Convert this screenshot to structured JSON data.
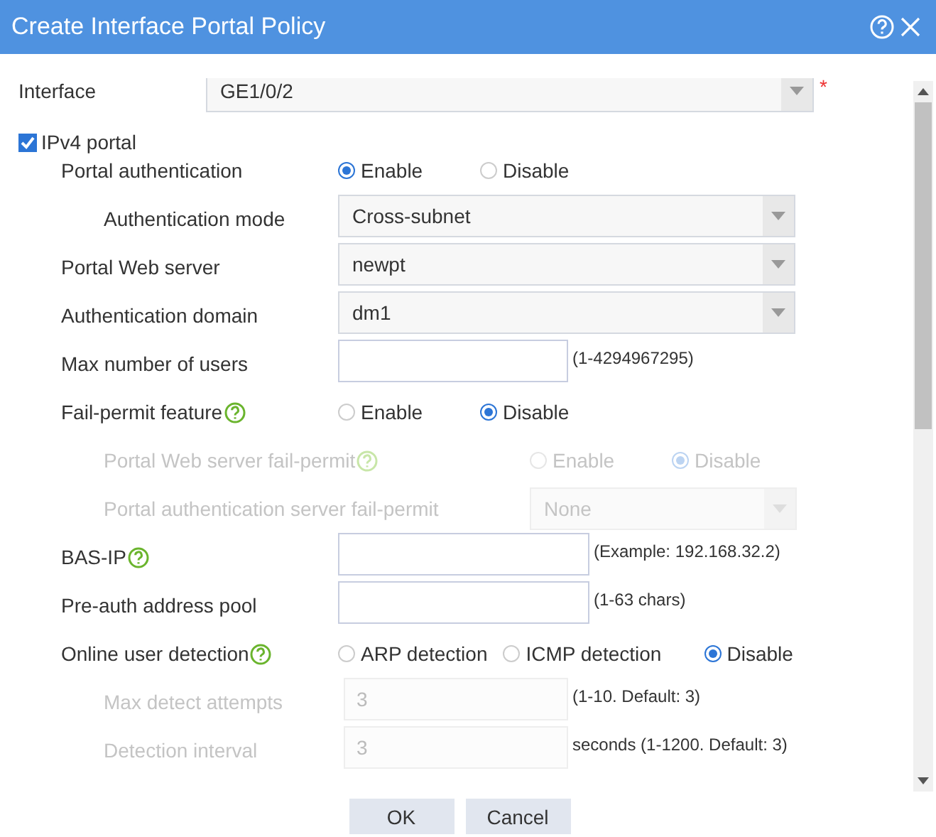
{
  "window": {
    "title": "Create Interface Portal Policy"
  },
  "rows": [
    {
      "kind": "select",
      "label": "Interface",
      "value": "GE1/0/2",
      "required_mark": "*"
    },
    {
      "kind": "checkbox",
      "label": "IPv4 portal",
      "checked": true,
      "children": [
        {
          "kind": "radio",
          "label": "Portal authentication",
          "options": [
            {
              "label": "Enable",
              "selected": true
            },
            {
              "label": "Disable",
              "selected": false
            }
          ],
          "children": [
            {
              "kind": "select",
              "label": "Authentication mode",
              "value": "Cross-subnet"
            }
          ]
        },
        {
          "kind": "select",
          "label": "Portal Web server",
          "value": "newpt"
        },
        {
          "kind": "select",
          "label": "Authentication domain",
          "value": "dm1"
        },
        {
          "kind": "text",
          "label": "Max number of users",
          "hint": "(1-4294967295)"
        },
        {
          "kind": "radio",
          "label": "Fail-permit feature",
          "help": true,
          "options": [
            {
              "label": "Enable",
              "selected": false
            },
            {
              "label": "Disable",
              "selected": true
            }
          ],
          "children": [
            {
              "kind": "radio",
              "label": "Portal Web server fail-permit",
              "help": true,
              "disabled": true,
              "options": [
                {
                  "label": "Enable",
                  "selected": false
                },
                {
                  "label": "Disable",
                  "selected": true
                }
              ]
            },
            {
              "kind": "select",
              "label": "Portal authentication server fail-permit",
              "value": "None",
              "disabled": true
            }
          ]
        },
        {
          "kind": "text",
          "label": "BAS-IP",
          "help": true,
          "hint": "(Example: 192.168.32.2)"
        },
        {
          "kind": "text",
          "label": "Pre-auth address pool",
          "hint": "(1-63 chars)"
        },
        {
          "kind": "radio",
          "label": "Online user detection",
          "help": true,
          "options": [
            {
              "label": "ARP detection",
              "selected": false
            },
            {
              "label": "ICMP detection",
              "selected": false
            },
            {
              "label": "Disable",
              "selected": true
            }
          ],
          "children": [
            {
              "kind": "text",
              "label": "Max detect attempts",
              "value": "3",
              "hint": "(1-10. Default: 3)",
              "disabled": true
            },
            {
              "kind": "text",
              "label": "Detection interval",
              "value": "3",
              "hint": "seconds (1-1200. Default: 3)",
              "disabled": true
            }
          ]
        }
      ]
    }
  ],
  "buttons": [
    "OK",
    "Cancel"
  ]
}
